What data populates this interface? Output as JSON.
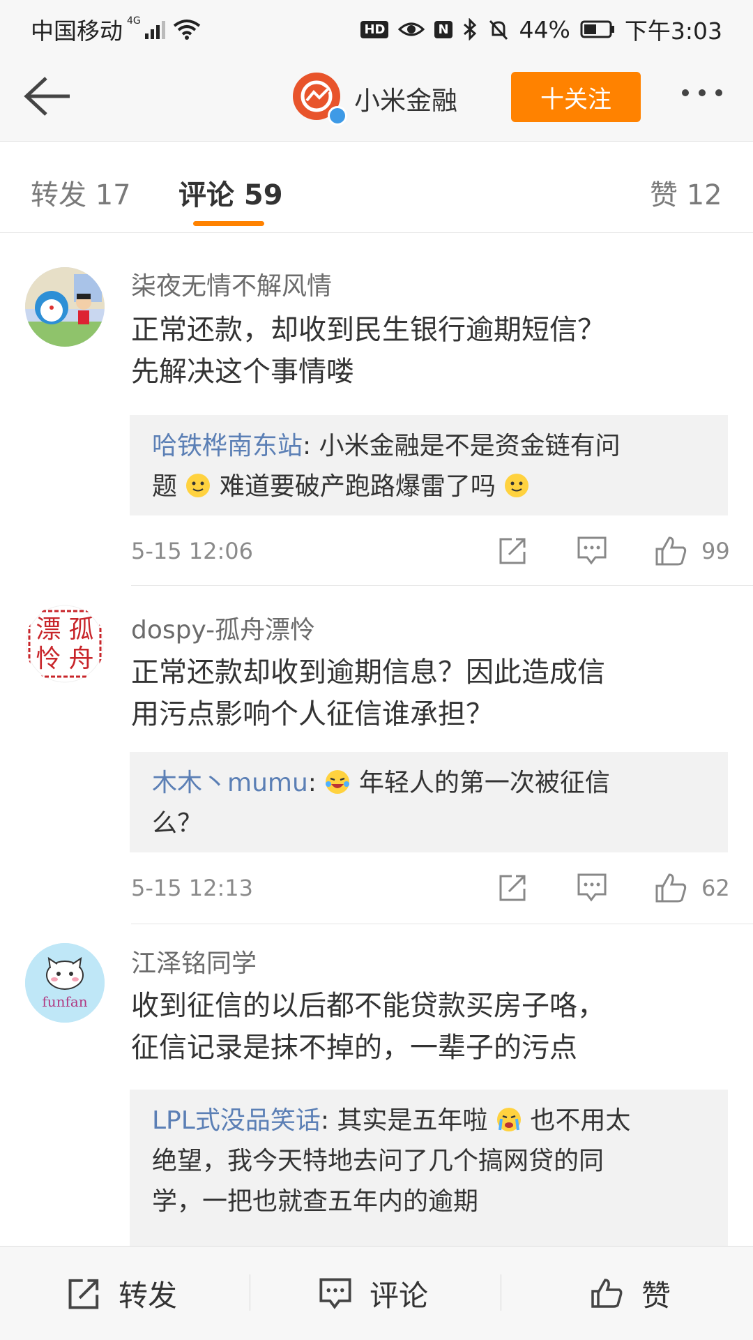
{
  "status": {
    "carrier": "中国移动",
    "network": "4G",
    "hd": "HD",
    "nfc": "N",
    "battery": "44%",
    "time": "下午3:03"
  },
  "header": {
    "account_name": "小米金融",
    "follow_label": "十关注",
    "brand_color": "#e8542b",
    "accent": "#ff8200"
  },
  "tabs": [
    {
      "label": "转发 17"
    },
    {
      "label": "评论 59"
    },
    {
      "label": "赞 12"
    }
  ],
  "comments": [
    {
      "user": "柒夜无情不解风情",
      "text_lines": [
        "正常还款，却收到民生银行逾期短信？",
        "先解决这个事情喽"
      ],
      "reply_user": "哈铁桦南东站",
      "reply_line1": ": 小米金融是不是资金链有问",
      "reply_line2_a": "题",
      "reply_line2_b": "难道要破产跑路爆雷了吗",
      "time": "5-15 12:06",
      "likes": "99"
    },
    {
      "user": "dospy-孤舟漂怜",
      "avatar_chars": [
        "漂",
        "孤",
        "怜",
        "舟"
      ],
      "text_lines": [
        "正常还款却收到逾期信息？因此造成信",
        "用污点影响个人征信谁承担？"
      ],
      "reply_user": "木木丶mumu",
      "reply_line1": "年轻人的第一次被征信",
      "reply_line2": "么？",
      "time": "5-15 12:13",
      "likes": "62"
    },
    {
      "user": "江泽铭同学",
      "avatar_text": "funfan",
      "text_lines": [
        "收到征信的以后都不能贷款买房子咯，",
        "征信记录是抹不掉的，一辈子的污点"
      ],
      "reply_user": "LPL式没品笑话",
      "reply_line1_a": ": 其实是五年啦",
      "reply_line1_b": "也不用太",
      "reply_line2": "绝望，我今天特地去问了几个搞网贷的同",
      "reply_line3": "学，一把也就查五年内的逾期"
    }
  ],
  "bottom": {
    "repost": "转发",
    "comment": "评论",
    "like": "赞"
  }
}
